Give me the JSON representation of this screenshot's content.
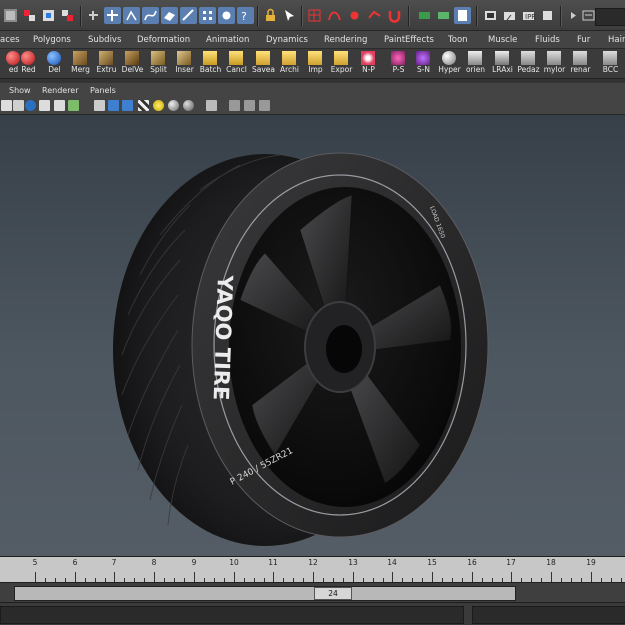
{
  "shelf_tabs": [
    "aces",
    "Polygons",
    "Subdivs",
    "Deformation",
    "Animation",
    "Dynamics",
    "Rendering",
    "PaintEffects",
    "Toon",
    "Muscle",
    "Fluids",
    "Fur",
    "Hair"
  ],
  "shelf_items": [
    {
      "label": "ed",
      "icon": "red-sphere-icon"
    },
    {
      "label": "Red",
      "icon": "red-sphere-icon"
    },
    {
      "label": "Del",
      "icon": "blue-sphere-icon"
    },
    {
      "label": "Merg",
      "icon": "merge-vertices-icon"
    },
    {
      "label": "Extru",
      "icon": "extrude-icon"
    },
    {
      "label": "DelVe",
      "icon": "delete-vertex-icon"
    },
    {
      "label": "Split",
      "icon": "split-polygon-icon"
    },
    {
      "label": "Inser",
      "icon": "insert-edge-loop-icon"
    },
    {
      "label": "Batch",
      "icon": "batch-render-icon"
    },
    {
      "label": "Cancl",
      "icon": "cancel-render-icon"
    },
    {
      "label": "Savea",
      "icon": "folder-icon"
    },
    {
      "label": "Archi",
      "icon": "folder-icon"
    },
    {
      "label": "Imp",
      "icon": "folder-icon"
    },
    {
      "label": "Expor",
      "icon": "folder-icon"
    },
    {
      "label": "N-P",
      "icon": "normals-icon"
    },
    {
      "label": "P-S",
      "icon": "p-s-icon"
    },
    {
      "label": "S-N",
      "icon": "s-n-icon"
    },
    {
      "label": "Hyper",
      "icon": "hypershade-icon"
    },
    {
      "label": "orien",
      "icon": "orient-icon"
    },
    {
      "label": "LRAxi",
      "icon": "local-axis-icon"
    },
    {
      "label": "Pedaz",
      "icon": "script-icon"
    },
    {
      "label": "mylor",
      "icon": "script-icon"
    },
    {
      "label": "renar",
      "icon": "script-icon"
    },
    {
      "label": "BCC",
      "icon": "script-icon"
    }
  ],
  "panel_menus": [
    "Show",
    "Renderer",
    "Panels"
  ],
  "tire": {
    "brand_text": "YAQO TIRE",
    "size_text": "P 240 / 55ZR21",
    "small_text": "LOAD 1650"
  },
  "timeline": {
    "ticks": [
      5,
      6,
      7,
      8,
      9,
      10,
      11,
      12,
      13,
      14,
      15,
      16,
      17,
      18,
      19
    ],
    "current_frame": "24"
  },
  "colors": {
    "viewport_top": "#374049",
    "viewport_bottom": "#545d66",
    "timeslider_bg": "#c7c7c7"
  }
}
